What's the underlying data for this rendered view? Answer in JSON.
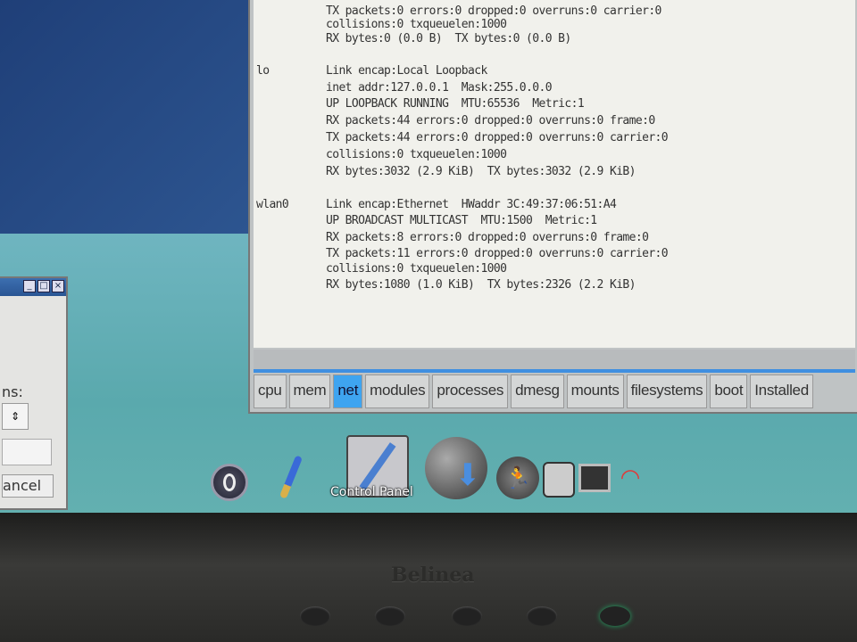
{
  "terminal": {
    "lines": [
      {
        "iface": "",
        "text": "TX packets:0 errors:0 dropped:0 overruns:0 carrier:0"
      },
      {
        "iface": "",
        "text": "collisions:0 txqueuelen:1000"
      },
      {
        "iface": "",
        "text": "RX bytes:0 (0.0 B)  TX bytes:0 (0.0 B)"
      },
      {
        "iface": "lo",
        "text": "Link encap:Local Loopback"
      },
      {
        "iface": "",
        "text": "inet addr:127.0.0.1  Mask:255.0.0.0"
      },
      {
        "iface": "",
        "text": "UP LOOPBACK RUNNING  MTU:65536  Metric:1"
      },
      {
        "iface": "",
        "text": "RX packets:44 errors:0 dropped:0 overruns:0 frame:0"
      },
      {
        "iface": "",
        "text": "TX packets:44 errors:0 dropped:0 overruns:0 carrier:0"
      },
      {
        "iface": "",
        "text": "collisions:0 txqueuelen:1000"
      },
      {
        "iface": "",
        "text": "RX bytes:3032 (2.9 KiB)  TX bytes:3032 (2.9 KiB)"
      },
      {
        "iface": "wlan0",
        "text": "Link encap:Ethernet  HWaddr 3C:49:37:06:51:A4"
      },
      {
        "iface": "",
        "text": "UP BROADCAST MULTICAST  MTU:1500  Metric:1"
      },
      {
        "iface": "",
        "text": "RX packets:8 errors:0 dropped:0 overruns:0 frame:0"
      },
      {
        "iface": "",
        "text": "TX packets:11 errors:0 dropped:0 overruns:0 carrier:0"
      },
      {
        "iface": "",
        "text": "collisions:0 txqueuelen:1000"
      },
      {
        "iface": "",
        "text": "RX bytes:1080 (1.0 KiB)  TX bytes:2326 (2.2 KiB)"
      }
    ]
  },
  "tabs": [
    {
      "label": "cpu",
      "selected": false
    },
    {
      "label": "mem",
      "selected": false
    },
    {
      "label": "net",
      "selected": true
    },
    {
      "label": "modules",
      "selected": false
    },
    {
      "label": "processes",
      "selected": false
    },
    {
      "label": "dmesg",
      "selected": false
    },
    {
      "label": "mounts",
      "selected": false
    },
    {
      "label": "filesystems",
      "selected": false
    },
    {
      "label": "boot",
      "selected": false
    },
    {
      "label": "Installed",
      "selected": false
    }
  ],
  "dialog": {
    "label_partial": "ns:",
    "cancel_partial": "ancel",
    "titlebar_buttons": [
      "minimize",
      "maximize",
      "close"
    ]
  },
  "dock": {
    "icons": [
      "power-icon",
      "paintbrush-icon",
      "control-panel-icon",
      "install-download-icon",
      "running-man-icon",
      "drive-icon",
      "monitor-icon",
      "wifi-icon"
    ],
    "tooltip": "Control Panel"
  },
  "monitor": {
    "brand": "Belinea"
  },
  "colors": {
    "selected_tab": "#3ea4f0",
    "desktop": "#5aa6aa",
    "terminal_bg": "#f1f1ec"
  }
}
